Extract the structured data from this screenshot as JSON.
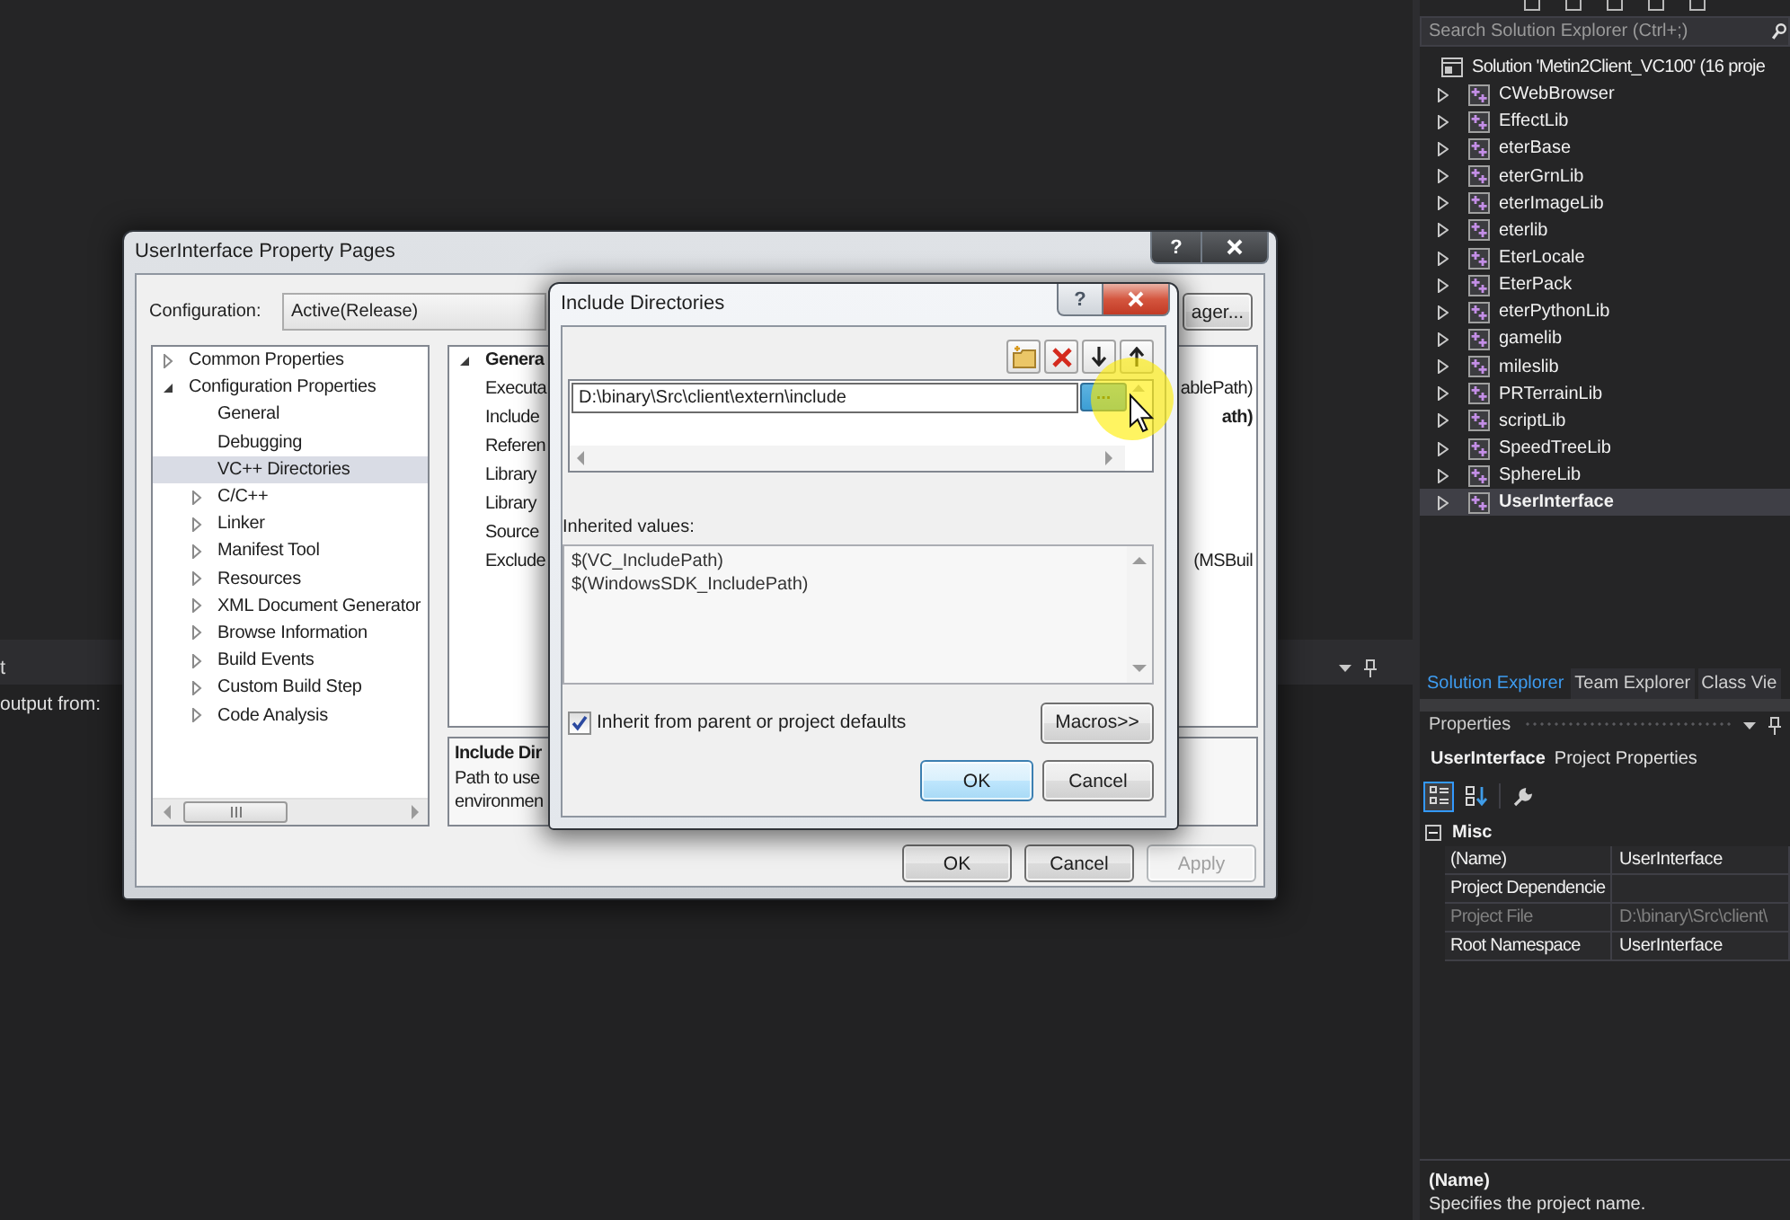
{
  "output_panel": {
    "title": "t",
    "source_label": "output from:"
  },
  "solution_explorer": {
    "search": {
      "placeholder": "Search Solution Explorer (Ctrl+;)"
    },
    "solution": "Solution 'Metin2Client_VC100' (16 proje",
    "projects": [
      {
        "name": "CWebBrowser",
        "expanded": false,
        "selected": false
      },
      {
        "name": "EffectLib",
        "expanded": false,
        "selected": false
      },
      {
        "name": "eterBase",
        "expanded": false,
        "selected": false
      },
      {
        "name": "eterGrnLib",
        "expanded": false,
        "selected": false
      },
      {
        "name": "eterImageLib",
        "expanded": false,
        "selected": false
      },
      {
        "name": "eterlib",
        "expanded": false,
        "selected": false
      },
      {
        "name": "EterLocale",
        "expanded": false,
        "selected": false
      },
      {
        "name": "EterPack",
        "expanded": false,
        "selected": false
      },
      {
        "name": "eterPythonLib",
        "expanded": false,
        "selected": false
      },
      {
        "name": "gamelib",
        "expanded": false,
        "selected": false
      },
      {
        "name": "mileslib",
        "expanded": false,
        "selected": false
      },
      {
        "name": "PRTerrainLib",
        "expanded": false,
        "selected": false
      },
      {
        "name": "scriptLib",
        "expanded": false,
        "selected": false
      },
      {
        "name": "SpeedTreeLib",
        "expanded": false,
        "selected": false
      },
      {
        "name": "SphereLib",
        "expanded": false,
        "selected": false
      },
      {
        "name": "UserInterface",
        "expanded": false,
        "selected": true
      }
    ]
  },
  "panel_tabs": [
    {
      "label": "Solution Explorer",
      "selected": true
    },
    {
      "label": "Team Explorer",
      "selected": false
    },
    {
      "label": "Class Vie",
      "selected": false
    }
  ],
  "properties": {
    "title": "Properties",
    "object_name": "UserInterface",
    "object_type": "Project Properties",
    "tools": [
      {
        "kind": "categorized",
        "selected": true
      },
      {
        "kind": "alphabetical",
        "selected": false
      },
      {
        "kind": "property_pages",
        "selected": false
      }
    ],
    "category": {
      "label": "Misc",
      "expanded": true,
      "rows": [
        {
          "name": "(Name)",
          "value": "UserInterface",
          "disabled": false
        },
        {
          "name": "Project Dependencie",
          "disabled": false
        },
        {
          "name": "Project File",
          "value": "D:\\binary\\Src\\client\\",
          "disabled": true
        },
        {
          "name": "Root Namespace",
          "value": "UserInterface",
          "disabled": false
        }
      ]
    },
    "description": {
      "title": "(Name)",
      "text": "Specifies the project name."
    }
  },
  "property_pages": {
    "title": "UserInterface Property Pages",
    "active": false,
    "help_label": "?",
    "configuration": {
      "label": "Configuration:",
      "value": "Active(Release)"
    },
    "manager_button": "ager...",
    "tree": [
      {
        "label": "Common Properties",
        "expanded": false,
        "selected": false
      },
      {
        "label": "Configuration Properties",
        "expanded": true,
        "selected": false,
        "children": [
          {
            "label": "General",
            "selected": false
          },
          {
            "label": "Debugging",
            "selected": false
          },
          {
            "label": "VC++ Directories",
            "selected": true
          },
          {
            "label": "C/C++",
            "expanded": false,
            "selected": false
          },
          {
            "label": "Linker",
            "expanded": false,
            "selected": false
          },
          {
            "label": "Manifest Tool",
            "expanded": false,
            "selected": false
          },
          {
            "label": "Resources",
            "expanded": false,
            "selected": false
          },
          {
            "label": "XML Document Generator",
            "expanded": false,
            "selected": false
          },
          {
            "label": "Browse Information",
            "expanded": false,
            "selected": false
          },
          {
            "label": "Build Events",
            "expanded": false,
            "selected": false
          },
          {
            "label": "Custom Build Step",
            "expanded": false,
            "selected": false
          },
          {
            "label": "Code Analysis",
            "expanded": false,
            "selected": false
          }
        ]
      }
    ],
    "grid": {
      "category": "Genera",
      "expanded": true,
      "rows": [
        {
          "name": "Executa",
          "value": "ablePath)",
          "modified": false
        },
        {
          "name": "Include",
          "value": "ath)",
          "modified": true
        },
        {
          "name": "Referen"
        },
        {
          "name": "Library"
        },
        {
          "name": "Library"
        },
        {
          "name": "Source"
        },
        {
          "name": "Exclude",
          "value": "(MSBuil",
          "modified": false
        }
      ]
    },
    "description": {
      "title": "Include Dir",
      "lines": [
        "Path to use",
        "environmen"
      ]
    },
    "buttons": [
      {
        "label": "OK",
        "disabled": false
      },
      {
        "label": "Cancel",
        "disabled": false
      },
      {
        "label": "Apply",
        "disabled": true
      }
    ]
  },
  "include_directories": {
    "title": "Include Directories",
    "active": true,
    "help_label": "?",
    "tools": [
      {
        "kind": "new_line"
      },
      {
        "kind": "delete"
      },
      {
        "kind": "move_down"
      },
      {
        "kind": "move_up"
      }
    ],
    "entries": [
      {
        "value": "D:\\binary\\Src\\client\\extern\\include",
        "editing": true
      }
    ],
    "browse_label": "...",
    "inherited_label": "Inherited values:",
    "inherited": [
      "$(VC_IncludePath)",
      "$(WindowsSDK_IncludePath)"
    ],
    "inherit": {
      "label": "Inherit from parent or project defaults",
      "checked": true
    },
    "macros_button": "Macros>>",
    "buttons": [
      {
        "label": "OK",
        "default": true
      },
      {
        "label": "Cancel",
        "default": false
      }
    ]
  }
}
